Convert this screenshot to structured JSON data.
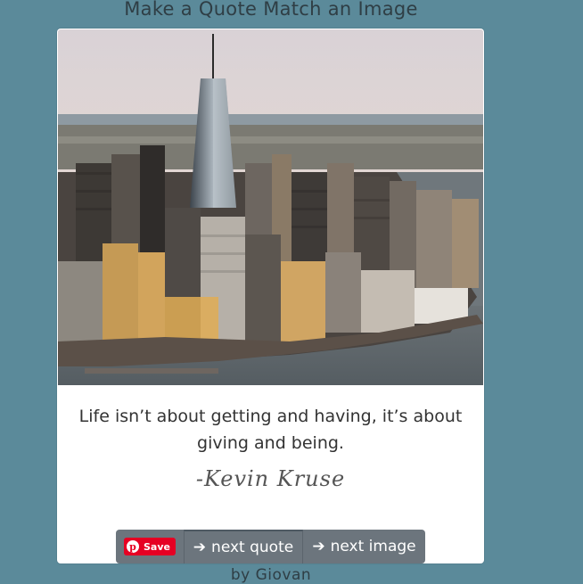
{
  "header": {
    "title": "Make a Quote Match an Image"
  },
  "photo": {
    "subject": "city-skyline-photo"
  },
  "quote": {
    "text": "Life isn’t about getting and having, it’s about giving and being.",
    "author": "-Kevin Kruse"
  },
  "buttons": {
    "pin_save_label": "Save",
    "next_quote_label": "next quote",
    "next_image_label": "next image",
    "arrow_icon": "arrow-right-icon",
    "pinterest_icon": "pinterest-icon"
  },
  "footer": {
    "byline": "by Giovan"
  },
  "colors": {
    "background": "#5b8a9a",
    "button": "#6c757d",
    "pinterest": "#e60023",
    "card": "#ffffff"
  }
}
